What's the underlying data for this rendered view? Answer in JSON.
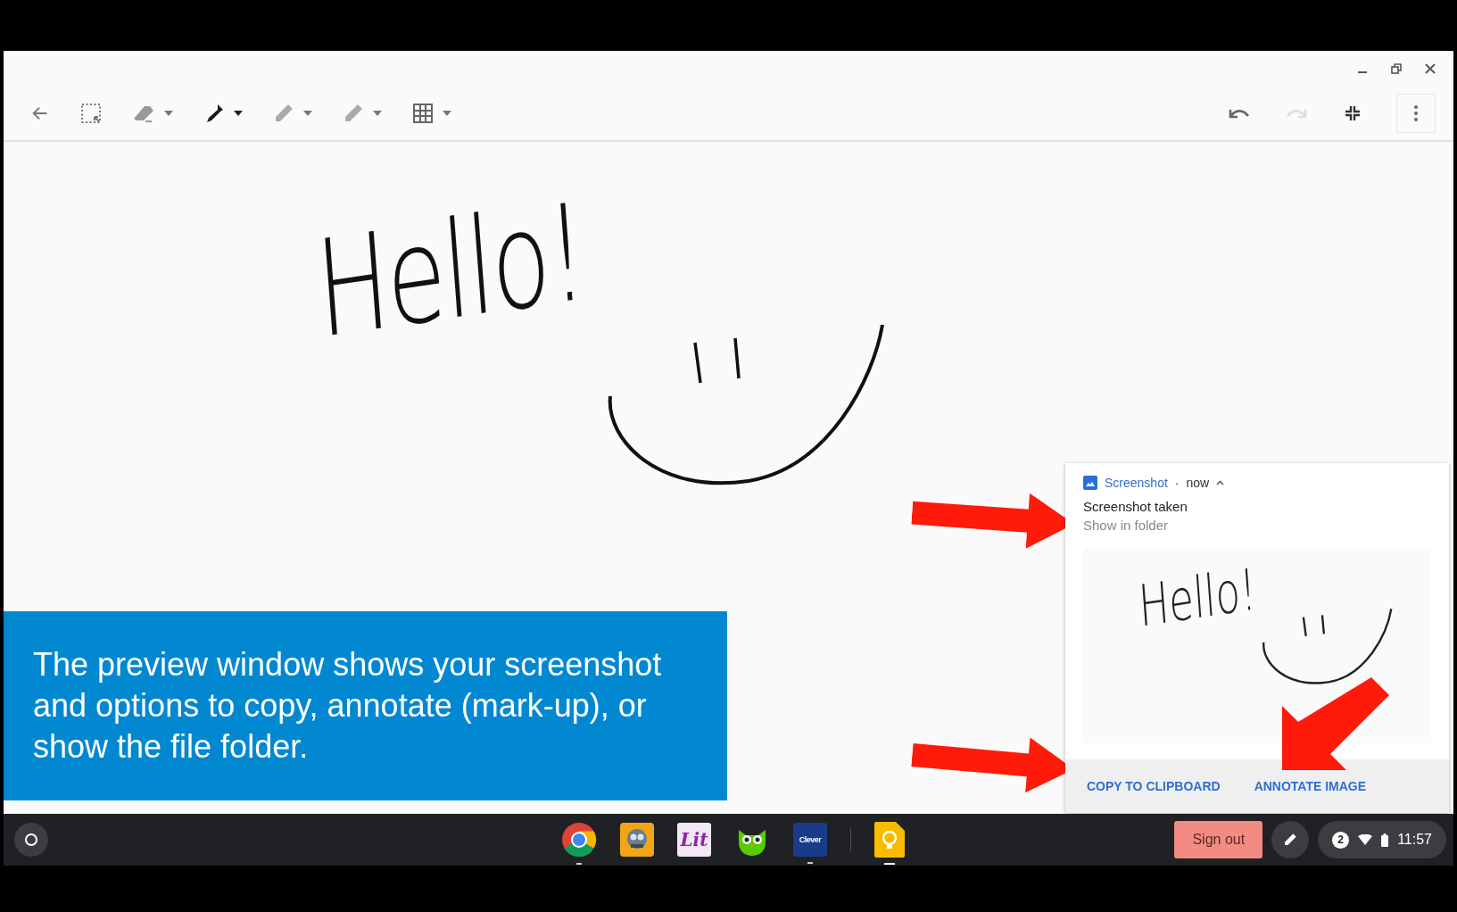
{
  "toolbar": {
    "tools": [
      {
        "kind": "back",
        "selected": false
      },
      {
        "kind": "select",
        "selected": false
      },
      {
        "kind": "eraser",
        "selected": false
      },
      {
        "kind": "pen",
        "selected": true
      },
      {
        "kind": "pencil",
        "selected": false
      },
      {
        "kind": "highlighter",
        "selected": false
      },
      {
        "kind": "grid",
        "selected": false
      }
    ],
    "actions": [
      {
        "kind": "undo",
        "disabled": false
      },
      {
        "kind": "redo",
        "disabled": true
      },
      {
        "kind": "fullscreen",
        "disabled": false
      },
      {
        "kind": "menu",
        "disabled": false
      }
    ]
  },
  "canvas": {
    "ink_text": "Hello!"
  },
  "caption": "The preview window shows your screenshot and options to copy, annotate (mark-up), or show the file folder.",
  "notification": {
    "app": "Screenshot",
    "separator": "·",
    "time": "now",
    "title": "Screenshot taken",
    "subtitle": "Show in folder",
    "preview_text": "Hello!",
    "actions": [
      "COPY TO CLIPBOARD",
      "ANNOTATE IMAGE"
    ]
  },
  "shelf": {
    "apps": [
      {
        "kind": "chrome",
        "running": true,
        "active": false
      },
      {
        "kind": "robot",
        "running": false,
        "active": false
      },
      {
        "kind": "lit",
        "label": "Lit",
        "running": false,
        "active": false
      },
      {
        "kind": "owl",
        "running": false,
        "active": false
      },
      {
        "kind": "clever",
        "label": "Clever",
        "running": true,
        "active": false
      },
      {
        "kind": "keep",
        "running": true,
        "active": true
      }
    ],
    "sign_out": "Sign out",
    "notification_count": "2",
    "time": "11:57"
  }
}
